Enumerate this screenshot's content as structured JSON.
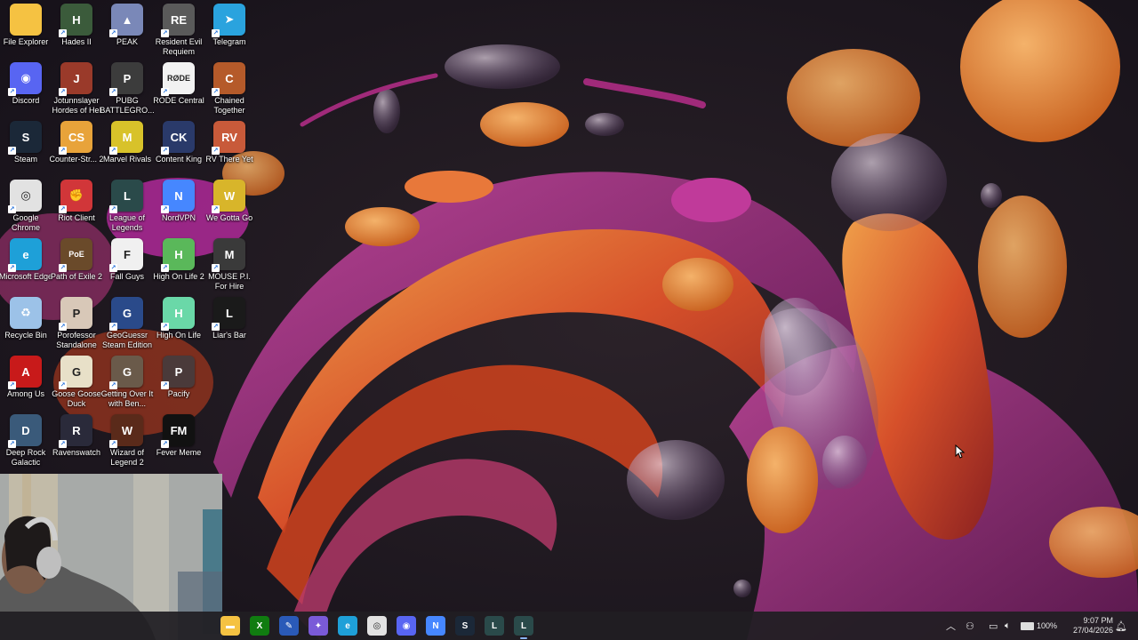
{
  "desktop": {
    "icons": [
      {
        "label": "File Explorer",
        "icon": "folder-icon",
        "color": "#f5c242",
        "glyph": ""
      },
      {
        "label": "Hades II",
        "icon": "hades-icon",
        "color": "#3b5b3b",
        "glyph": "H"
      },
      {
        "label": "PEAK",
        "icon": "peak-icon",
        "color": "#7a88b8",
        "glyph": "▲"
      },
      {
        "label": "Resident Evil Requiem",
        "icon": "resident-evil-icon",
        "color": "#5a5a5a",
        "glyph": "RE"
      },
      {
        "label": "Telegram",
        "icon": "telegram-icon",
        "color": "#2aa3de",
        "glyph": "➤"
      },
      {
        "label": "Discord",
        "icon": "discord-icon",
        "color": "#5865f2",
        "glyph": "◉"
      },
      {
        "label": "Jotunnslayer Hordes of Hel",
        "icon": "jotunnslayer-icon",
        "color": "#9a3a2a",
        "glyph": "J"
      },
      {
        "label": "PUBG BATTLEGRO...",
        "icon": "pubg-icon",
        "color": "#3c3c3c",
        "glyph": "P"
      },
      {
        "label": "RODE Central",
        "icon": "rode-icon",
        "color": "#f2f2f2",
        "glyph": "RØDE"
      },
      {
        "label": "Chained Together",
        "icon": "chained-together-icon",
        "color": "#b55a2a",
        "glyph": "C"
      },
      {
        "label": "Steam",
        "icon": "steam-icon",
        "color": "#1b2838",
        "glyph": "S"
      },
      {
        "label": "Counter-Str... 2",
        "icon": "counter-strike-icon",
        "color": "#e8a33a",
        "glyph": "CS"
      },
      {
        "label": "Marvel Rivals",
        "icon": "marvel-rivals-icon",
        "color": "#d8c22a",
        "glyph": "M"
      },
      {
        "label": "Content King",
        "icon": "content-king-icon",
        "color": "#2a3a6a",
        "glyph": "CK"
      },
      {
        "label": "RV There Yet",
        "icon": "rv-there-yet-icon",
        "color": "#c85a3a",
        "glyph": "RV"
      },
      {
        "label": "Google Chrome",
        "icon": "chrome-icon",
        "color": "#e2e2e2",
        "glyph": "◎"
      },
      {
        "label": "Riot Client",
        "icon": "riot-client-icon",
        "color": "#d13639",
        "glyph": "✊"
      },
      {
        "label": "League of Legends",
        "icon": "league-icon",
        "color": "#2a4a4a",
        "glyph": "L"
      },
      {
        "label": "NordVPN",
        "icon": "nordvpn-icon",
        "color": "#4687ff",
        "glyph": "N"
      },
      {
        "label": "We Gotta Go",
        "icon": "we-gotta-go-icon",
        "color": "#d8b52a",
        "glyph": "W"
      },
      {
        "label": "Microsoft Edge",
        "icon": "edge-icon",
        "color": "#1ea0d8",
        "glyph": "e"
      },
      {
        "label": "Path of Exile 2",
        "icon": "path-of-exile-icon",
        "color": "#6a4a2a",
        "glyph": "PoE"
      },
      {
        "label": "Fall Guys",
        "icon": "fall-guys-icon",
        "color": "#f0f0f0",
        "glyph": "F"
      },
      {
        "label": "High On Life 2",
        "icon": "high-on-life-2-icon",
        "color": "#5ab85a",
        "glyph": "H"
      },
      {
        "label": "MOUSE P.I. For Hire",
        "icon": "mouse-pi-icon",
        "color": "#3a3a3a",
        "glyph": "M"
      },
      {
        "label": "Recycle Bin",
        "icon": "recycle-bin-icon",
        "color": "#9cc2e8",
        "glyph": "♻"
      },
      {
        "label": "Porofessor Standalone",
        "icon": "porofessor-icon",
        "color": "#d8c8b8",
        "glyph": "P"
      },
      {
        "label": "GeoGuessr Steam Edition",
        "icon": "geoguessr-icon",
        "color": "#2a4a8a",
        "glyph": "G"
      },
      {
        "label": "High On Life",
        "icon": "high-on-life-icon",
        "color": "#6ad8a8",
        "glyph": "H"
      },
      {
        "label": "Liar's Bar",
        "icon": "liars-bar-icon",
        "color": "#1a1a1a",
        "glyph": "L"
      },
      {
        "label": "Among Us",
        "icon": "among-us-icon",
        "color": "#c81a1a",
        "glyph": "A"
      },
      {
        "label": "Goose Goose Duck",
        "icon": "goose-goose-duck-icon",
        "color": "#e8e0c8",
        "glyph": "G"
      },
      {
        "label": "Getting Over It with Ben...",
        "icon": "getting-over-it-icon",
        "color": "#6a5a4a",
        "glyph": "G"
      },
      {
        "label": "Pacify",
        "icon": "pacify-icon",
        "color": "#4a3a3a",
        "glyph": "P"
      },
      {
        "label": "Deep Rock Galactic",
        "icon": "deep-rock-galactic-icon",
        "color": "#3a5a7a",
        "glyph": "D"
      },
      {
        "label": "Ravenswatch",
        "icon": "ravenswatch-icon",
        "color": "#2a2a3a",
        "glyph": "R"
      },
      {
        "label": "Wizard of Legend 2",
        "icon": "wizard-of-legend-icon",
        "color": "#5a2a1a",
        "glyph": "W"
      },
      {
        "label": "Fever Meme",
        "icon": "fever-meme-icon",
        "color": "#111111",
        "glyph": "FM"
      }
    ]
  },
  "taskbar": {
    "apps": [
      {
        "name": "file-explorer",
        "icon": "folder-icon",
        "color": "#f5c242",
        "glyph": "▬"
      },
      {
        "name": "xbox",
        "icon": "xbox-icon",
        "color": "#107c10",
        "glyph": "X"
      },
      {
        "name": "tool",
        "icon": "tool-icon",
        "color": "#2a5ab8",
        "glyph": "✎"
      },
      {
        "name": "copilot",
        "icon": "copilot-icon",
        "color": "#7a5ad8",
        "glyph": "✦"
      },
      {
        "name": "edge",
        "icon": "edge-icon",
        "color": "#1ea0d8",
        "glyph": "e"
      },
      {
        "name": "chrome",
        "icon": "chrome-icon",
        "color": "#e2e2e2",
        "glyph": "◎"
      },
      {
        "name": "discord",
        "icon": "discord-icon",
        "color": "#5865f2",
        "glyph": "◉"
      },
      {
        "name": "nordvpn",
        "icon": "nordvpn-icon",
        "color": "#4687ff",
        "glyph": "N"
      },
      {
        "name": "steam-chat",
        "icon": "steam-icon",
        "color": "#1b2838",
        "glyph": "S"
      },
      {
        "name": "league",
        "icon": "league-icon",
        "color": "#2a4a4a",
        "glyph": "L"
      },
      {
        "name": "league-active",
        "icon": "league-icon",
        "color": "#2a4a4a",
        "glyph": "L"
      }
    ],
    "tray": {
      "battery": "100%",
      "time": "9:07 PM",
      "date": "27/04/2026"
    }
  }
}
